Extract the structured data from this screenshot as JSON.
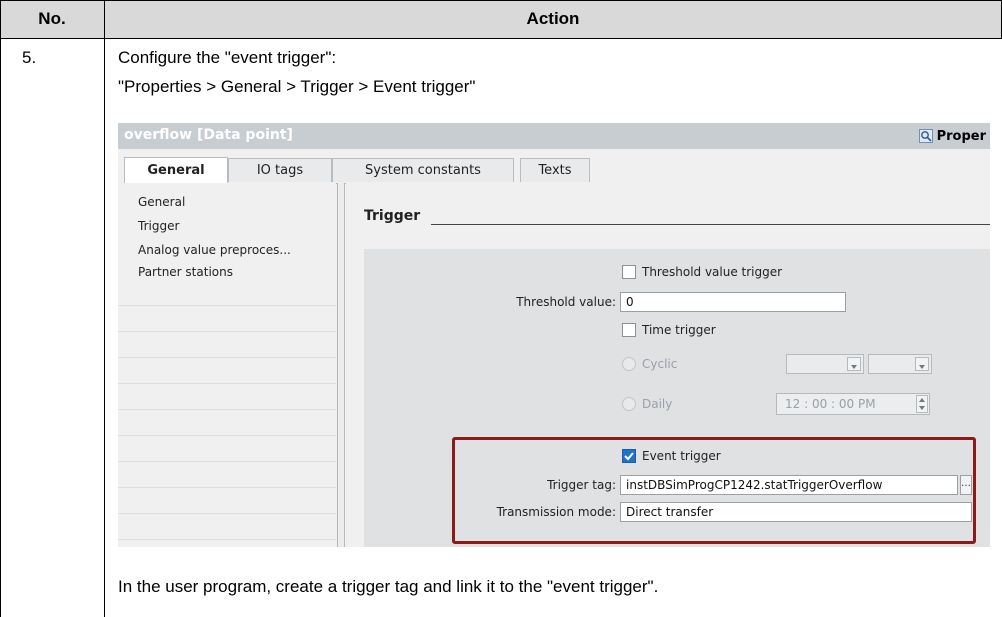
{
  "table": {
    "header_no": "No.",
    "header_action": "Action",
    "step_number": "5.",
    "instruction_line1": "Configure the \"event trigger\":",
    "instruction_line2": "\"Properties > General > Trigger > Event trigger\"",
    "footer_text": "In the user program, create a trigger tag and link it to the \"event trigger\"."
  },
  "screenshot": {
    "title": "overflow [Data point]",
    "properties_label": "Proper",
    "tabs": [
      {
        "label": "General",
        "active": true
      },
      {
        "label": "IO tags",
        "active": false
      },
      {
        "label": "System constants",
        "active": false
      },
      {
        "label": "Texts",
        "active": false
      }
    ],
    "nav_items": [
      "General",
      "Trigger",
      "Analog value preproces...",
      "Partner stations"
    ],
    "section_title": "Trigger",
    "threshold_trigger_label": "Threshold value trigger",
    "threshold_value_label": "Threshold value:",
    "threshold_value": "0",
    "time_trigger_label": "Time trigger",
    "cyclic_label": "Cyclic",
    "daily_label": "Daily",
    "daily_time": "12 : 00 : 00   PM",
    "event_trigger_label": "Event trigger",
    "event_trigger_checked": true,
    "trigger_tag_label": "Trigger tag:",
    "trigger_tag_value": "instDBSimProgCP1242.statTriggerOverflow",
    "transmission_mode_label": "Transmission mode:",
    "transmission_mode_value": "Direct transfer",
    "highlight_color": "#8b1a1a"
  }
}
